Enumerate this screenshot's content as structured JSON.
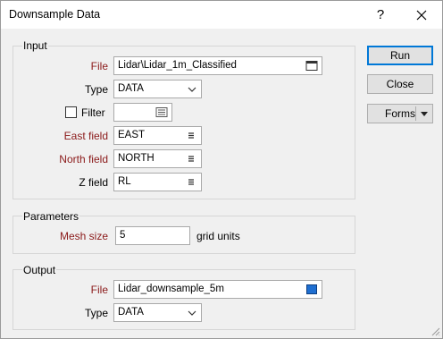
{
  "window": {
    "title": "Downsample Data",
    "help_glyph": "?",
    "close_glyph": "✕"
  },
  "input": {
    "group_title": "Input",
    "file_label": "File",
    "file_value": "Lidar\\Lidar_1m_Classified",
    "type_label": "Type",
    "type_value": "DATA",
    "filter_label": "Filter",
    "filter_checked": false,
    "filter_value": "",
    "east_label": "East field",
    "east_value": "EAST",
    "north_label": "North field",
    "north_value": "NORTH",
    "z_label": "Z field",
    "z_value": "RL"
  },
  "parameters": {
    "group_title": "Parameters",
    "mesh_label": "Mesh size",
    "mesh_value": "5",
    "mesh_units": "grid units"
  },
  "output": {
    "group_title": "Output",
    "file_label": "File",
    "file_value": "Lidar_downsample_5m",
    "type_label": "Type",
    "type_value": "DATA"
  },
  "buttons": {
    "run": "Run",
    "close": "Close",
    "forms": "Forms"
  },
  "colors": {
    "required_label": "#8b1a1a",
    "default_button_border": "#0078d7",
    "output_file_icon": "#1f6fd1"
  },
  "icons": {
    "file_browse": "file-browse-icon",
    "output_file": "output-file-icon",
    "field_list": "field-list-icon",
    "combo_arrow": "chevron-down-icon",
    "filter_builder": "filter-builder-icon",
    "forms_dropdown": "dropdown-arrow-icon",
    "resize_grip": "resize-grip-icon"
  }
}
